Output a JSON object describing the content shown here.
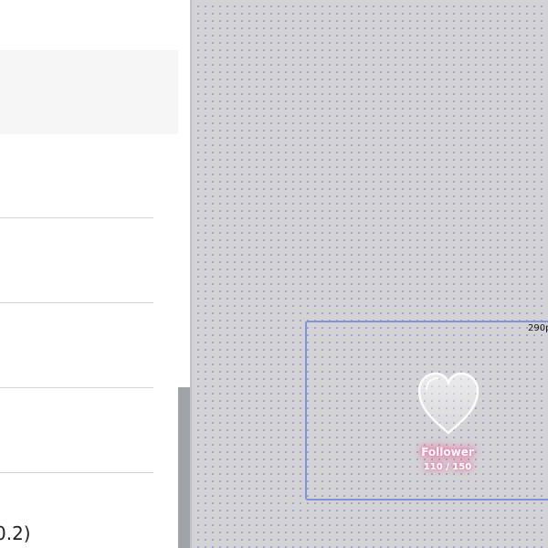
{
  "left_panel": {
    "partial_text": "0.2)"
  },
  "canvas": {
    "widget": {
      "size_label": "290p",
      "goal_title": "Follower",
      "goal_count": "110 / 150",
      "goal_current": 110,
      "goal_target": 150,
      "icon": "heart-icon",
      "glow_color": "#f06e9c",
      "frame_color": "#7f96d6"
    }
  }
}
